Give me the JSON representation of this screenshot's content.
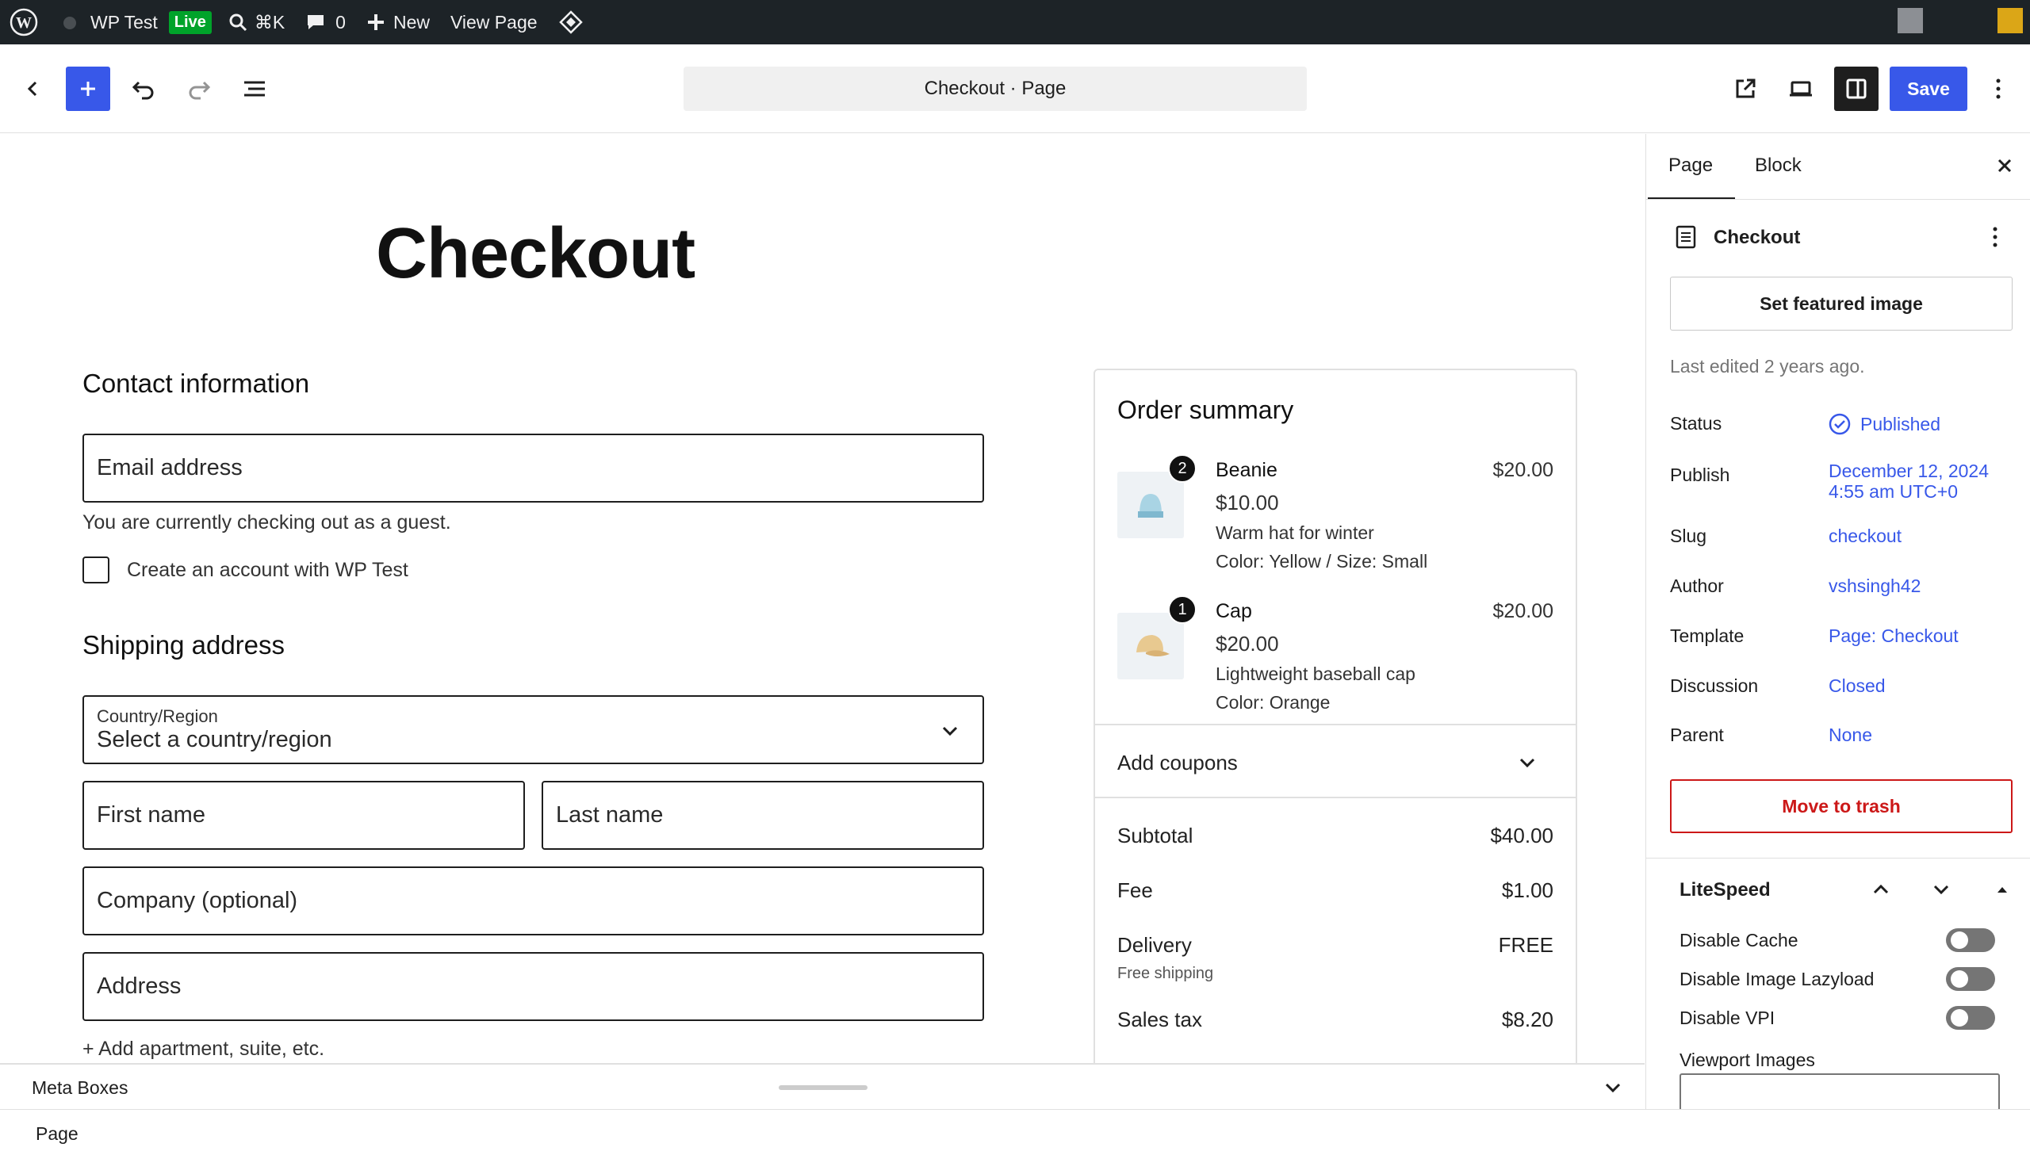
{
  "admin_bar": {
    "site_name": "WP Test",
    "live_badge": "Live",
    "shortcut": "⌘K",
    "comments_count": "0",
    "new_label": "New",
    "view_page_label": "View Page"
  },
  "header": {
    "document_title": "Checkout · Page",
    "save_label": "Save"
  },
  "canvas": {
    "page_title": "Checkout",
    "contact": {
      "heading": "Contact information",
      "email_placeholder": "Email address",
      "guest_note": "You are currently checking out as a guest.",
      "create_account_label": "Create an account with WP Test"
    },
    "shipping": {
      "heading": "Shipping address",
      "country_label": "Country/Region",
      "country_value": "Select a country/region",
      "first_name": "First name",
      "last_name": "Last name",
      "company": "Company (optional)",
      "address": "Address",
      "add_apartment": "+ Add apartment, suite, etc."
    },
    "order_summary": {
      "heading": "Order summary",
      "items": [
        {
          "qty": "2",
          "name": "Beanie",
          "total": "$20.00",
          "price": "$10.00",
          "description": "Warm hat for winter",
          "attributes": "Color: Yellow / Size: Small"
        },
        {
          "qty": "1",
          "name": "Cap",
          "total": "$20.00",
          "price": "$20.00",
          "description": "Lightweight baseball cap",
          "attributes": "Color: Orange"
        }
      ],
      "coupons_label": "Add coupons",
      "subtotal_label": "Subtotal",
      "subtotal_value": "$40.00",
      "fee_label": "Fee",
      "fee_value": "$1.00",
      "delivery_label": "Delivery",
      "delivery_value": "FREE",
      "delivery_note": "Free shipping",
      "tax_label": "Sales tax",
      "tax_value": "$8.20"
    }
  },
  "meta_boxes": {
    "label": "Meta Boxes"
  },
  "footer": {
    "breadcrumb": "Page"
  },
  "sidebar": {
    "tabs": [
      "Page",
      "Block"
    ],
    "doc_title": "Checkout",
    "featured_image_label": "Set featured image",
    "last_edited": "Last edited 2 years ago.",
    "properties": [
      {
        "label": "Status",
        "value": "Published"
      },
      {
        "label": "Publish",
        "value": "December 12, 2024",
        "value2": "4:55 am UTC+0"
      },
      {
        "label": "Slug",
        "value": "checkout"
      },
      {
        "label": "Author",
        "value": "vshsingh42"
      },
      {
        "label": "Template",
        "value": "Page: Checkout"
      },
      {
        "label": "Discussion",
        "value": "Closed"
      },
      {
        "label": "Parent",
        "value": "None"
      }
    ],
    "trash_label": "Move to trash",
    "litespeed": {
      "title": "LiteSpeed",
      "options": [
        "Disable Cache",
        "Disable Image Lazyload",
        "Disable VPI"
      ],
      "viewport_label": "Viewport Images"
    }
  },
  "colors": {
    "accent": "#3858e9",
    "admin_bar": "#1d2327",
    "live": "#00a32a",
    "danger": "#cc1818"
  }
}
